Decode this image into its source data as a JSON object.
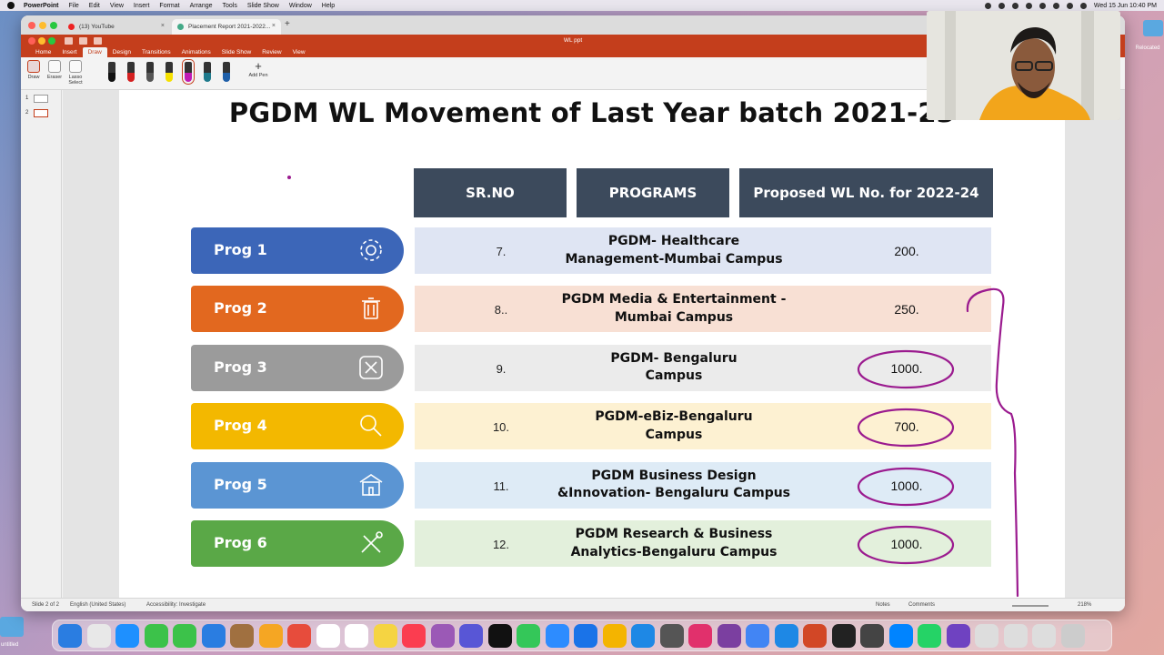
{
  "menubar": {
    "app_name": "PowerPoint",
    "items": [
      "File",
      "Edit",
      "View",
      "Insert",
      "Format",
      "Arrange",
      "Tools",
      "Slide Show",
      "Window",
      "Help"
    ],
    "datetime": "Wed 15 Jun  10:40 PM"
  },
  "desktop": {
    "folder_label": "Relocated",
    "bottom_label": "untitled"
  },
  "browser": {
    "tabs": [
      {
        "label": "(13) YouTube"
      },
      {
        "label": "Placement Report 2021-2022..."
      }
    ]
  },
  "powerpoint": {
    "file_title": "WL ppt",
    "ribbon_tabs": [
      "Home",
      "Insert",
      "Draw",
      "Design",
      "Transitions",
      "Animations",
      "Slide Show",
      "Review",
      "View"
    ],
    "active_tab": "Draw",
    "tools": {
      "draw": "Draw",
      "eraser": "Eraser",
      "lasso": "Lasso Select",
      "add_pen": "Add Pen"
    },
    "pen_colors": [
      "#111111",
      "#d42020",
      "#555555",
      "#f5e000",
      "#c01bb5",
      "#1f7a8c",
      "#1f5fa8"
    ],
    "slide_numbers": [
      "1",
      "2"
    ],
    "status": {
      "slide": "Slide 2 of 2",
      "language": "English (United States)",
      "accessibility": "Accessibility: Investigate",
      "notes": "Notes",
      "comments": "Comments",
      "zoom": "218%"
    }
  },
  "slide": {
    "title": "PGDM WL Movement of Last Year batch 2021-23",
    "headers": {
      "srno": "SR.NO",
      "programs": "PROGRAMS",
      "proposed": "Proposed WL No. for  2022-24"
    },
    "rows": [
      {
        "prog": "Prog 1",
        "sr": "7.",
        "program_line1": "PGDM- Healthcare",
        "program_line2": "Management-Mumbai  Campus",
        "wl": "200.",
        "color": "#3c66b8",
        "row_bg": "#dfe5f3",
        "icon": "gear-icon",
        "circled": false
      },
      {
        "prog": "Prog 2",
        "sr": "8..",
        "program_line1": "PGDM Media & Entertainment -",
        "program_line2": "Mumbai  Campus",
        "wl": "250.",
        "color": "#e2681f",
        "row_bg": "#f8e0d4",
        "icon": "trash-icon",
        "circled": false
      },
      {
        "prog": "Prog 3",
        "sr": "9.",
        "program_line1": "PGDM- Bengaluru",
        "program_line2": "Campus",
        "wl": "1000.",
        "color": "#9b9b9b",
        "row_bg": "#ebebeb",
        "icon": "close-box-icon",
        "circled": true
      },
      {
        "prog": "Prog 4",
        "sr": "10.",
        "program_line1": "PGDM-eBiz-Bengaluru",
        "program_line2": "Campus",
        "wl": "700.",
        "color": "#f3b800",
        "row_bg": "#fdf1d2",
        "icon": "search-icon",
        "circled": true
      },
      {
        "prog": "Prog 5",
        "sr": "11.",
        "program_line1": "PGDM Business Design",
        "program_line2": "&Innovation- Bengaluru  Campus",
        "wl": "1000.",
        "color": "#5b95d3",
        "row_bg": "#deebf6",
        "icon": "building-icon",
        "circled": true
      },
      {
        "prog": "Prog 6",
        "sr": "12.",
        "program_line1": "PGDM Research & Business",
        "program_line2": "Analytics-Bengaluru Campus",
        "wl": "1000.",
        "color": "#5aa847",
        "row_bg": "#e3f0dc",
        "icon": "tools-icon",
        "circled": true
      }
    ]
  }
}
